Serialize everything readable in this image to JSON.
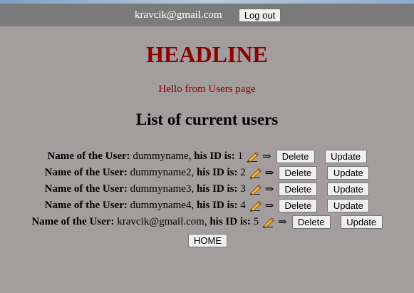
{
  "header": {
    "user_email": "kravcik@gmail.com",
    "logout_label": "Log out"
  },
  "main": {
    "headline": "HEADLINE",
    "greeting": "Hello from Users page",
    "list_title": "List of current users",
    "name_label": "Name of the User:",
    "id_label": "his ID is:",
    "arrow": "⇒",
    "delete_label": "Delete",
    "update_label": "Update",
    "pencil_icon": "pencil-icon",
    "users": [
      {
        "name": "dummyname",
        "id": "1"
      },
      {
        "name": "dummyname2",
        "id": "2"
      },
      {
        "name": "dummyname3",
        "id": "3"
      },
      {
        "name": "dummyname4",
        "id": "4"
      },
      {
        "name": "kravcik@gmail.com",
        "id": "5"
      }
    ],
    "home_label": "HOME"
  },
  "colors": {
    "page_background": "#a39d9d",
    "header_background": "#7b7b7b",
    "headline": "#8b0000"
  }
}
